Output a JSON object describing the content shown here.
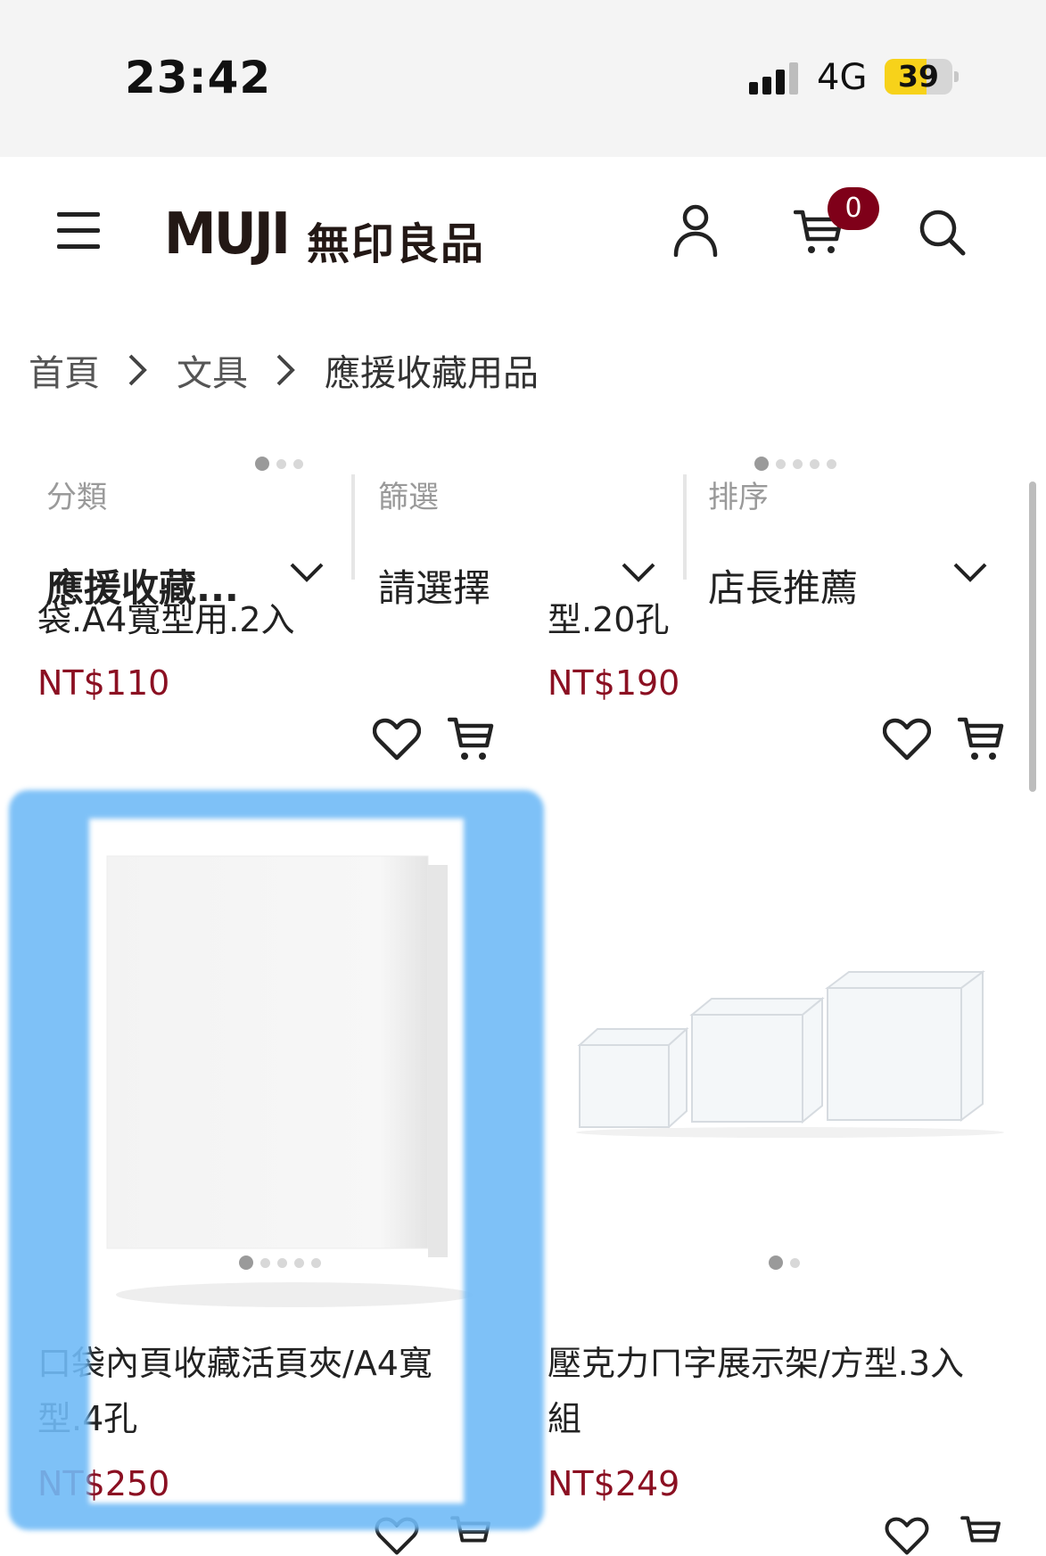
{
  "status_bar": {
    "time": "23:42",
    "network": "4G",
    "battery": "39",
    "battery_level": 0.62
  },
  "header": {
    "logo_en": "MUJI",
    "logo_cn": "無印良品",
    "cart_count": "0"
  },
  "breadcrumb": [
    "首頁",
    "文具",
    "應援收藏用品"
  ],
  "filters": [
    {
      "label": "分類",
      "value": "應援收藏..."
    },
    {
      "label": "篩選",
      "value": "請選擇"
    },
    {
      "label": "排序",
      "value": "店長推薦"
    }
  ],
  "products_top": [
    {
      "name": "袋.A4寬型用.2入",
      "price": "NT$110"
    },
    {
      "name": "型.20孔",
      "price": "NT$190"
    }
  ],
  "products": [
    {
      "name_line1": "口袋內頁收藏活頁夾/A4寬",
      "name_line2": "型.4孔",
      "price": "NT$250"
    },
    {
      "name_line1": "壓克力ㄇ字展示架/方型.3入",
      "name_line2": "組",
      "price": "NT$249"
    }
  ],
  "colors": {
    "brand_red": "#7f0019",
    "price_red": "#8b1022",
    "highlight": "#70baf6"
  },
  "icons": [
    "menu-icon",
    "account-icon",
    "cart-icon",
    "search-icon",
    "chevron-right-icon",
    "chevron-down-icon",
    "heart-icon",
    "add-to-cart-icon"
  ]
}
